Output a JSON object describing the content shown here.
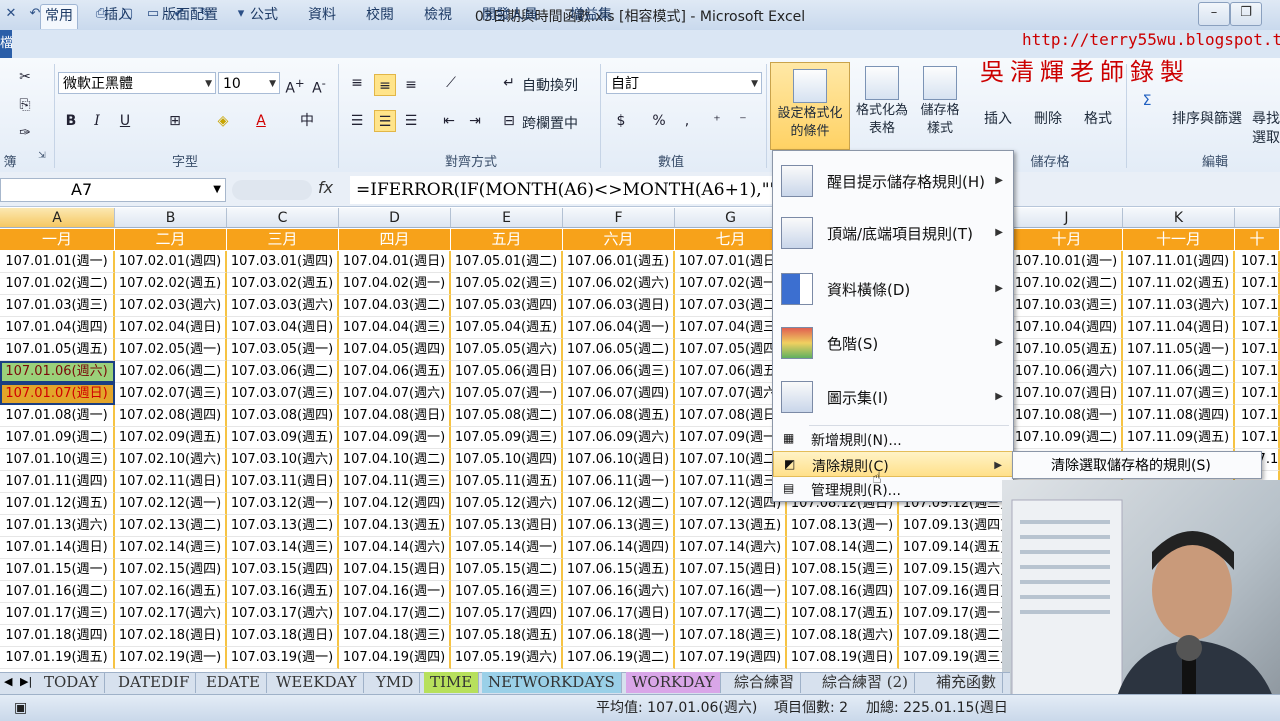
{
  "window": {
    "title": "03日期與時間函數.xls  [相容模式] - Microsoft Excel",
    "file_tab": "檔案"
  },
  "tabs": [
    "常用",
    "插入",
    "版面配置",
    "公式",
    "資料",
    "校閱",
    "檢視",
    "開發人員",
    "增益集"
  ],
  "watermark": {
    "url": "http://terry55wu.blogspot.tw",
    "author": "吳清輝老師錄製"
  },
  "ribbon": {
    "font_name": "微軟正黑體",
    "font_size": "10",
    "wrap_text": "自動換列",
    "merge_center": "跨欄置中",
    "number_format": "自訂",
    "conditional_format": [
      "設定格式化",
      "的條件"
    ],
    "format_as_table": [
      "格式化為",
      "表格"
    ],
    "cell_styles": [
      "儲存格",
      "樣式"
    ],
    "insert": "插入",
    "delete": "刪除",
    "format": "格式",
    "sort_filter": "排序與篩選",
    "find_select": [
      "尋找",
      "選取"
    ],
    "groups": {
      "clipboard": "簿",
      "font": "字型",
      "alignment": "對齊方式",
      "number": "數值",
      "cells": "儲存格",
      "editing": "編輯"
    },
    "bold": "B",
    "italic": "I",
    "underline": "U",
    "percent": "%",
    "currency": "$"
  },
  "formula_bar": {
    "name_box": "A7",
    "fx": "fx",
    "formula": "=IFERROR(IF(MONTH(A6)<>MONTH(A6+1),\"\",A6"
  },
  "columns": [
    "A",
    "B",
    "C",
    "D",
    "E",
    "F",
    "G",
    "J",
    "K",
    "L"
  ],
  "months": [
    "一月",
    "二月",
    "三月",
    "四月",
    "五月",
    "六月",
    "七月",
    "八月",
    "九月",
    "十月",
    "十一月",
    "十"
  ],
  "rows": [
    [
      "107.01.01(週一)",
      "107.02.01(週四)",
      "107.03.01(週四)",
      "107.04.01(週日)",
      "107.05.01(週二)",
      "107.06.01(週五)",
      "107.07.01(週日)",
      "",
      "",
      "107.10.01(週一)",
      "107.11.01(週四)",
      "107.12"
    ],
    [
      "107.01.02(週二)",
      "107.02.02(週五)",
      "107.03.02(週五)",
      "107.04.02(週一)",
      "107.05.02(週三)",
      "107.06.02(週六)",
      "107.07.02(週一)",
      "",
      "",
      "107.10.02(週二)",
      "107.11.02(週五)",
      "107.12"
    ],
    [
      "107.01.03(週三)",
      "107.02.03(週六)",
      "107.03.03(週六)",
      "107.04.03(週二)",
      "107.05.03(週四)",
      "107.06.03(週日)",
      "107.07.03(週二)",
      "",
      "",
      "107.10.03(週三)",
      "107.11.03(週六)",
      "107.12"
    ],
    [
      "107.01.04(週四)",
      "107.02.04(週日)",
      "107.03.04(週日)",
      "107.04.04(週三)",
      "107.05.04(週五)",
      "107.06.04(週一)",
      "107.07.04(週三)",
      "",
      "",
      "107.10.04(週四)",
      "107.11.04(週日)",
      "107.12"
    ],
    [
      "107.01.05(週五)",
      "107.02.05(週一)",
      "107.03.05(週一)",
      "107.04.05(週四)",
      "107.05.05(週六)",
      "107.06.05(週二)",
      "107.07.05(週四)",
      "",
      "",
      "107.10.05(週五)",
      "107.11.05(週一)",
      "107.12"
    ],
    [
      "107.01.06(週六)",
      "107.02.06(週二)",
      "107.03.06(週二)",
      "107.04.06(週五)",
      "107.05.06(週日)",
      "107.06.06(週三)",
      "107.07.06(週五)",
      "",
      "",
      "107.10.06(週六)",
      "107.11.06(週二)",
      "107.12"
    ],
    [
      "107.01.07(週日)",
      "107.02.07(週三)",
      "107.03.07(週三)",
      "107.04.07(週六)",
      "107.05.07(週一)",
      "107.06.07(週四)",
      "107.07.07(週六)",
      "",
      "",
      "107.10.07(週日)",
      "107.11.07(週三)",
      "107.12"
    ],
    [
      "107.01.08(週一)",
      "107.02.08(週四)",
      "107.03.08(週四)",
      "107.04.08(週日)",
      "107.05.08(週二)",
      "107.06.08(週五)",
      "107.07.08(週日)",
      "",
      "",
      "107.10.08(週一)",
      "107.11.08(週四)",
      "107.12"
    ],
    [
      "107.01.09(週二)",
      "107.02.09(週五)",
      "107.03.09(週五)",
      "107.04.09(週一)",
      "107.05.09(週三)",
      "107.06.09(週六)",
      "107.07.09(週一)",
      "",
      "",
      "107.10.09(週二)",
      "107.11.09(週五)",
      "107.12"
    ],
    [
      "107.01.10(週三)",
      "107.02.10(週六)",
      "107.03.10(週六)",
      "107.04.10(週二)",
      "107.05.10(週四)",
      "107.06.10(週日)",
      "107.07.10(週二)",
      "",
      "",
      "",
      "",
      "107.12"
    ],
    [
      "107.01.11(週四)",
      "107.02.11(週日)",
      "107.03.11(週日)",
      "107.04.11(週三)",
      "107.05.11(週五)",
      "107.06.11(週一)",
      "107.07.11(週三)",
      "",
      "",
      "",
      "",
      ""
    ],
    [
      "107.01.12(週五)",
      "107.02.12(週一)",
      "107.03.12(週一)",
      "107.04.12(週四)",
      "107.05.12(週六)",
      "107.06.12(週二)",
      "107.07.12(週四)",
      "107.08.12(週日)",
      "107.09.12(週三)",
      "",
      "",
      ""
    ],
    [
      "107.01.13(週六)",
      "107.02.13(週二)",
      "107.03.13(週二)",
      "107.04.13(週五)",
      "107.05.13(週日)",
      "107.06.13(週三)",
      "107.07.13(週五)",
      "107.08.13(週一)",
      "107.09.13(週四)",
      "",
      "",
      ""
    ],
    [
      "107.01.14(週日)",
      "107.02.14(週三)",
      "107.03.14(週三)",
      "107.04.14(週六)",
      "107.05.14(週一)",
      "107.06.14(週四)",
      "107.07.14(週六)",
      "107.08.14(週二)",
      "107.09.14(週五)",
      "",
      "",
      ""
    ],
    [
      "107.01.15(週一)",
      "107.02.15(週四)",
      "107.03.15(週四)",
      "107.04.15(週日)",
      "107.05.15(週二)",
      "107.06.15(週五)",
      "107.07.15(週日)",
      "107.08.15(週三)",
      "107.09.15(週六)",
      "",
      "",
      ""
    ],
    [
      "107.01.16(週二)",
      "107.02.16(週五)",
      "107.03.16(週五)",
      "107.04.16(週一)",
      "107.05.16(週三)",
      "107.06.16(週六)",
      "107.07.16(週一)",
      "107.08.16(週四)",
      "107.09.16(週日)",
      "",
      "",
      ""
    ],
    [
      "107.01.17(週三)",
      "107.02.17(週六)",
      "107.03.17(週六)",
      "107.04.17(週二)",
      "107.05.17(週四)",
      "107.06.17(週日)",
      "107.07.17(週二)",
      "107.08.17(週五)",
      "107.09.17(週一)",
      "",
      "",
      ""
    ],
    [
      "107.01.18(週四)",
      "107.02.18(週日)",
      "107.03.18(週日)",
      "107.04.18(週三)",
      "107.05.18(週五)",
      "107.06.18(週一)",
      "107.07.18(週三)",
      "107.08.18(週六)",
      "107.09.18(週二)",
      "",
      "",
      ""
    ],
    [
      "107.01.19(週五)",
      "107.02.19(週一)",
      "107.03.19(週一)",
      "107.04.19(週四)",
      "107.05.19(週六)",
      "107.06.19(週二)",
      "107.07.19(週四)",
      "107.08.19(週日)",
      "107.09.19(週三)",
      "",
      "",
      ""
    ]
  ],
  "cf_menu": {
    "items": [
      {
        "label": "醒目提示儲存格規則(H)",
        "submenu": true
      },
      {
        "label": "頂端/底端項目規則(T)",
        "submenu": true
      },
      {
        "label": "資料橫條(D)",
        "submenu": true
      },
      {
        "label": "色階(S)",
        "submenu": true
      },
      {
        "label": "圖示集(I)",
        "submenu": true
      }
    ],
    "new_rule": "新增規則(N)...",
    "clear_rules": "清除規則(C)",
    "manage_rules": "管理規則(R)..."
  },
  "submenu": {
    "clear_selected": "清除選取儲存格的規則(S)"
  },
  "sheet_tabs": [
    "TODAY",
    "DATEDIF",
    "EDATE",
    "WEEKDAY",
    "YMD",
    "TIME",
    "NETWORKDAYS",
    "WORKDAY",
    "綜合練習",
    "綜合練習 (2)",
    "補充函數"
  ],
  "status": {
    "average": "平均值: 107.01.06(週六)",
    "count": "項目個數: 2",
    "sum": "加總: 225.01.15(週日"
  },
  "colors": {
    "accent_orange": "#f7a21a",
    "highlight_green": "#9bd17a",
    "highlight_amber": "#e3a52a",
    "ribbon_blue": "#dae6f4"
  }
}
